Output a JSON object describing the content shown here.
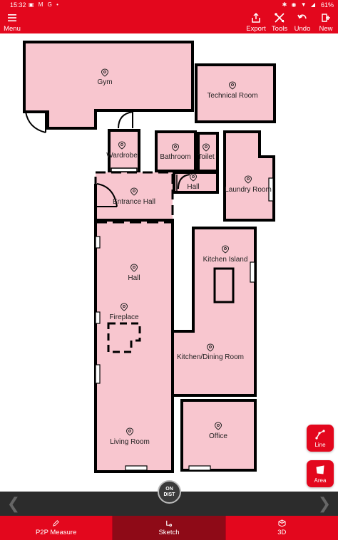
{
  "status_bar": {
    "time": "15:32",
    "left_icons": "▣ M G •",
    "right_icons": "✱ ◉ ▼ ◢",
    "battery": "61%"
  },
  "toolbar": {
    "menu_label": "Menu",
    "export_label": "Export",
    "tools_label": "Tools",
    "undo_label": "Undo",
    "new_label": "New"
  },
  "rooms": {
    "gym": "Gym",
    "technical_room": "Technical Room",
    "wardrobe": "Wardrobe",
    "bathroom": "Bathroom",
    "toilet": "Toilet",
    "laundry_room": "Laundry Room",
    "entrance_hall": "Entrance Hall",
    "small_hall": "Hall",
    "kitchen_island": "Kitchen Island",
    "hall": "Hall",
    "fireplace": "Fireplace",
    "kitchen_dining_room": "Kitchen/Dining Room",
    "living_room": "Living Room",
    "office": "Office"
  },
  "fabs": {
    "line_label": "Line",
    "area_label": "Area"
  },
  "on_dist": {
    "line1": "ON",
    "line2": "DIST"
  },
  "bottom_tabs": {
    "p2p_label": "P2P Measure",
    "sketch_label": "Sketch",
    "view3d_label": "3D"
  },
  "colors": {
    "brand_red": "#e3071d",
    "active_tab": "#8e0a17",
    "room_fill": "#f8c6cf"
  }
}
